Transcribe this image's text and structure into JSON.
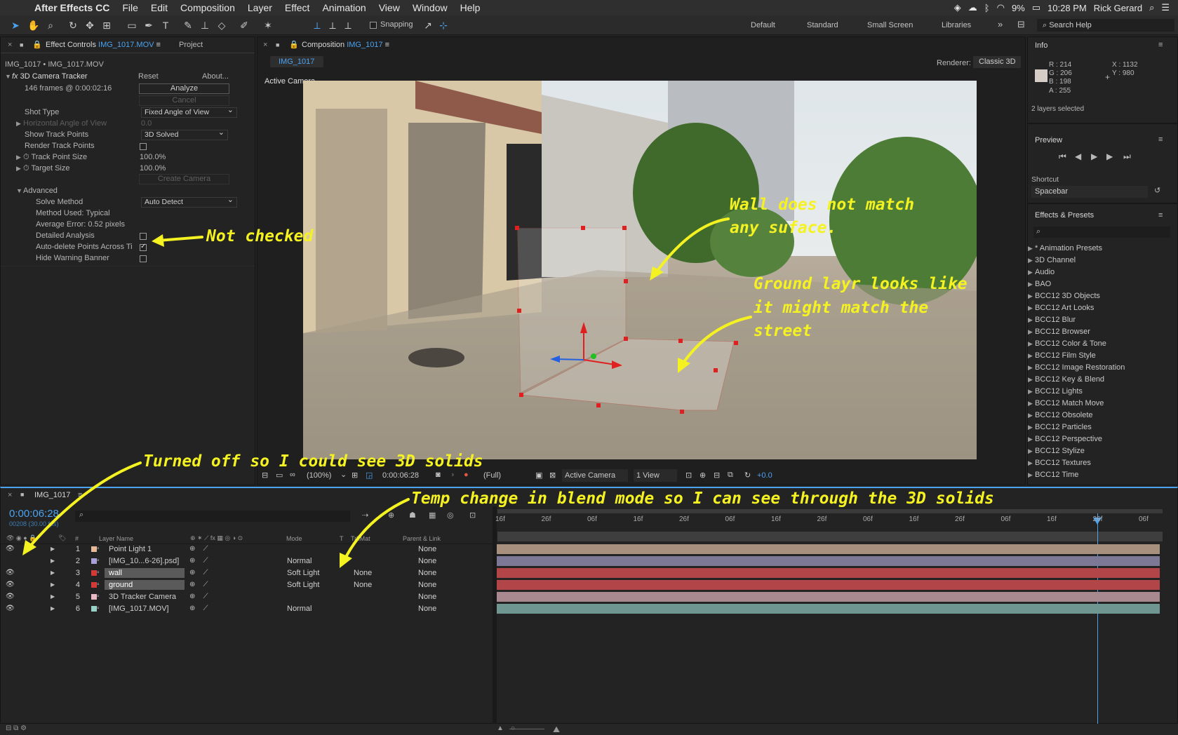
{
  "menubar": {
    "app": "After Effects CC",
    "items": [
      "File",
      "Edit",
      "Composition",
      "Layer",
      "Effect",
      "Animation",
      "View",
      "Window",
      "Help"
    ],
    "battery": "9%",
    "time": "10:28 PM",
    "user": "Rick Gerard"
  },
  "toolbar": {
    "snapping": "Snapping",
    "workspaces": [
      "Default",
      "Standard",
      "Small Screen",
      "Libraries"
    ],
    "search_placeholder": "Search Help"
  },
  "effect_controls": {
    "tab_prefix": "Effect Controls",
    "tab_file": "IMG_1017.MOV",
    "project_tab": "Project",
    "breadcrumb": "IMG_1017 • IMG_1017.MOV",
    "effect_name": "3D Camera Tracker",
    "reset": "Reset",
    "about": "About...",
    "frames": "146 frames @ 0:00:02:16",
    "analyze": "Analyze",
    "cancel": "Cancel",
    "shot_type_label": "Shot Type",
    "shot_type_value": "Fixed Angle of View",
    "hangle_label": "Horizontal Angle of View",
    "hangle_value": "0.0",
    "show_points_label": "Show Track Points",
    "show_points_value": "3D Solved",
    "render_points_label": "Render Track Points",
    "point_size_label": "Track Point Size",
    "point_size_value": "100.0%",
    "target_size_label": "Target Size",
    "target_size_value": "100.0%",
    "create_camera": "Create Camera",
    "advanced": "Advanced",
    "solve_method_label": "Solve Method",
    "solve_method_value": "Auto Detect",
    "method_used": "Method Used: Typical",
    "avg_error": "Average Error: 0.52 pixels",
    "detailed_label": "Detailed Analysis",
    "autodelete_label": "Auto-delete Points Across Ti",
    "hide_warning_label": "Hide Warning Banner"
  },
  "composition": {
    "tab_prefix": "Composition",
    "tab_name": "IMG_1017",
    "subtab": "IMG_1017",
    "renderer_label": "Renderer:",
    "renderer_value": "Classic 3D",
    "view_label": "Active Camera",
    "footer": {
      "zoom": "(100%)",
      "timecode": "0:00:06:28",
      "resolution": "(Full)",
      "camera": "Active Camera",
      "views": "1 View",
      "exposure": "+0.0"
    }
  },
  "annotations": {
    "wall": [
      "Wall does not match",
      "any suface."
    ],
    "ground": [
      "Ground layr looks like",
      "it might match the",
      "street"
    ],
    "not_checked": "Not checked",
    "turned_off": "Turned off so I could see 3D solids",
    "blend": "Temp change in blend mode so I can see through the 3D solids"
  },
  "info": {
    "title": "Info",
    "r": "R : 214",
    "g": "G : 206",
    "b": "B : 198",
    "a": "A : 255",
    "x": "X : 1132",
    "y": "Y : 980",
    "selected": "2 layers selected",
    "swatch": "#d6cec6"
  },
  "preview": {
    "title": "Preview",
    "shortcut_label": "Shortcut",
    "shortcut_value": "Spacebar"
  },
  "effects_presets": {
    "title": "Effects & Presets",
    "items": [
      "* Animation Presets",
      "3D Channel",
      "Audio",
      "BAO",
      "BCC12 3D Objects",
      "BCC12 Art Looks",
      "BCC12 Blur",
      "BCC12 Browser",
      "BCC12 Color & Tone",
      "BCC12 Film Style",
      "BCC12 Image Restoration",
      "BCC12 Key & Blend",
      "BCC12 Lights",
      "BCC12 Match Move",
      "BCC12 Obsolete",
      "BCC12 Particles",
      "BCC12 Perspective",
      "BCC12 Stylize",
      "BCC12 Textures",
      "BCC12 Time"
    ]
  },
  "timeline": {
    "tab": "IMG_1017",
    "timecode": "0:00:06:28",
    "frames": "00208 (30.00 fps)",
    "headers": {
      "num": "#",
      "layer_name": "Layer Name",
      "mode": "Mode",
      "t": "T",
      "trkmat": "TrkMat",
      "parent": "Parent & Link"
    },
    "ruler": [
      "16f",
      "26f",
      "06f",
      "16f",
      "26f",
      "06f",
      "16f",
      "26f",
      "06f",
      "16f",
      "26f",
      "06f",
      "16f",
      "26f",
      "06f"
    ],
    "layers": [
      {
        "num": "1",
        "name": "Point Light 1",
        "mode": "",
        "trkmat": "",
        "parent": "None",
        "label": "#e6b99a",
        "bar": "#a8907f",
        "eye": "●"
      },
      {
        "num": "2",
        "name": "[IMG_10...6-26].psd]",
        "mode": "Normal",
        "trkmat": "",
        "parent": "None",
        "label": "#a8a2d8",
        "bar": "#7d7895",
        "eye": ""
      },
      {
        "num": "3",
        "name": "wall",
        "mode": "Soft Light",
        "trkmat": "None",
        "parent": "None",
        "label": "#d23a3a",
        "bar": "#b14548",
        "eye": "●"
      },
      {
        "num": "4",
        "name": "ground",
        "mode": "Soft Light",
        "trkmat": "None",
        "parent": "None",
        "label": "#d23a3a",
        "bar": "#b14548",
        "eye": "●"
      },
      {
        "num": "5",
        "name": "3D Tracker Camera",
        "mode": "",
        "trkmat": "",
        "parent": "None",
        "label": "#e6b9c4",
        "bar": "#a7898f",
        "eye": "●"
      },
      {
        "num": "6",
        "name": "[IMG_1017.MOV]",
        "mode": "Normal",
        "trkmat": "",
        "parent": "None",
        "label": "#9ad1c6",
        "bar": "#6f9690",
        "eye": "●"
      }
    ]
  }
}
